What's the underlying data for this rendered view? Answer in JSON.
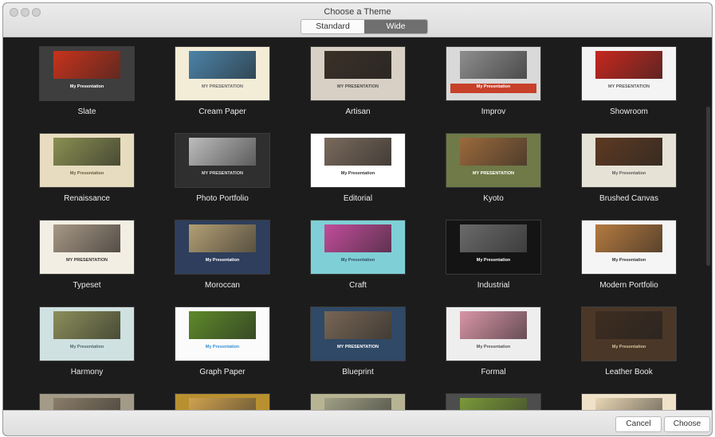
{
  "window": {
    "title": "Choose a Theme"
  },
  "segmented": {
    "standard": "Standard",
    "wide": "Wide",
    "selected": "Wide"
  },
  "themes": [
    {
      "name": "Slate",
      "bg": "#3e3e3e",
      "pic": "#c8331c",
      "title": "My Presentation",
      "tcolor": "#ffffff"
    },
    {
      "name": "Cream Paper",
      "bg": "#f3ecd7",
      "pic": "#4c83a8",
      "title": "MY PRESENTATION",
      "tcolor": "#6b6b6b"
    },
    {
      "name": "Artisan",
      "bg": "#d8d0c4",
      "pic": "#3a3027",
      "title": "MY PRESENTATION",
      "tcolor": "#4a4a4a"
    },
    {
      "name": "Improv",
      "bg": "#d9d9d9",
      "pic": "#8e8e8e",
      "title": "My Presentation",
      "tcolor": "#ffffff",
      "band": "#c7402a"
    },
    {
      "name": "Showroom",
      "bg": "#f4f4f4",
      "pic": "#c62820",
      "title": "MY PRESENTATION",
      "tcolor": "#5a5a5a"
    },
    {
      "name": "Renaissance",
      "bg": "#e7dcc0",
      "pic": "#8a8f52",
      "title": "My Presentation",
      "tcolor": "#6a5b3d"
    },
    {
      "name": "Photo Portfolio",
      "bg": "#2f2f2f",
      "pic": "#bdbdbd",
      "title": "MY PRESENTATION",
      "tcolor": "#dcdcdc"
    },
    {
      "name": "Editorial",
      "bg": "#ffffff",
      "pic": "#7a6a5c",
      "title": "My Presentation",
      "tcolor": "#333333"
    },
    {
      "name": "Kyoto",
      "bg": "#6f7a48",
      "pic": "#9b6a3c",
      "title": "MY PRESENTATION",
      "tcolor": "#ffffff"
    },
    {
      "name": "Brushed Canvas",
      "bg": "#e6e2d6",
      "pic": "#5d3a22",
      "title": "My Presentation",
      "tcolor": "#5b5b5b"
    },
    {
      "name": "Typeset",
      "bg": "#f3eee3",
      "pic": "#a79886",
      "title": "MY PRESENTATION",
      "tcolor": "#333333"
    },
    {
      "name": "Moroccan",
      "bg": "#2e3e5c",
      "pic": "#b39f74",
      "title": "My Presentation",
      "tcolor": "#ffffff"
    },
    {
      "name": "Craft",
      "bg": "#7fd0d6",
      "pic": "#c24d9b",
      "title": "My Presentation",
      "tcolor": "#2d4d66"
    },
    {
      "name": "Industrial",
      "bg": "#141414",
      "pic": "#6a6a6a",
      "title": "My Presentation",
      "tcolor": "#ffffff"
    },
    {
      "name": "Modern Portfolio",
      "bg": "#f5f5f5",
      "pic": "#b57a3f",
      "title": "My Presentation",
      "tcolor": "#333333"
    },
    {
      "name": "Harmony",
      "bg": "#cfe1e0",
      "pic": "#8b8f5a",
      "title": "My Presentation",
      "tcolor": "#4c6a6d"
    },
    {
      "name": "Graph Paper",
      "bg": "#fbfbfb",
      "pic": "#5d8a2a",
      "title": "My Presentation",
      "tcolor": "#3a8fd0"
    },
    {
      "name": "Blueprint",
      "bg": "#2f4966",
      "pic": "#776655",
      "title": "MY PRESENTATION",
      "tcolor": "#ffffff"
    },
    {
      "name": "Formal",
      "bg": "#eeeeee",
      "pic": "#d995a8",
      "title": "My Presentation",
      "tcolor": "#555555"
    },
    {
      "name": "Leather Book",
      "bg": "#4b3728",
      "pic": "#3e2d20",
      "title": "My Presentation",
      "tcolor": "#d7c39a"
    },
    {
      "name": "",
      "bg": "#a39b88",
      "pic": "#8b7d68",
      "title": "",
      "tcolor": "#ffffff"
    },
    {
      "name": "",
      "bg": "#b8902f",
      "pic": "#d0a250",
      "title": "",
      "tcolor": "#ffffff"
    },
    {
      "name": "",
      "bg": "#b6b493",
      "pic": "#a0a086",
      "title": "",
      "tcolor": "#ffffff"
    },
    {
      "name": "",
      "bg": "#4d4d4d",
      "pic": "#7b9a3a",
      "title": "",
      "tcolor": "#ffffff"
    },
    {
      "name": "",
      "bg": "#efe2c9",
      "pic": "#e8d6b4",
      "title": "",
      "tcolor": "#ffffff"
    }
  ],
  "buttons": {
    "cancel": "Cancel",
    "choose": "Choose"
  }
}
